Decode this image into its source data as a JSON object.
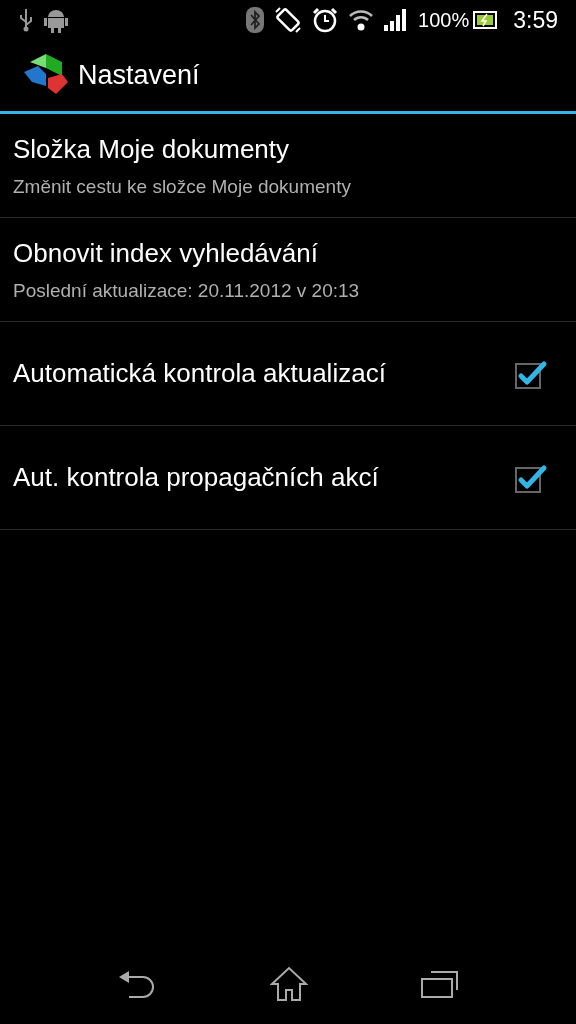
{
  "status_bar": {
    "battery": "100%",
    "time": "3:59"
  },
  "action_bar": {
    "title": "Nastavení"
  },
  "settings": [
    {
      "kind": "text",
      "title": "Složka Moje dokumenty",
      "summary": "Změnit cestu ke složce Moje dokumenty"
    },
    {
      "kind": "text",
      "title": "Obnovit index vyhledávání",
      "summary": "Poslední aktualizace: 20.11.2012 v 20:13"
    },
    {
      "kind": "checkbox",
      "title": "Automatická kontrola aktualizací",
      "checked": true
    },
    {
      "kind": "checkbox",
      "title": "Aut. kontrola propagačních akcí",
      "checked": true
    }
  ]
}
